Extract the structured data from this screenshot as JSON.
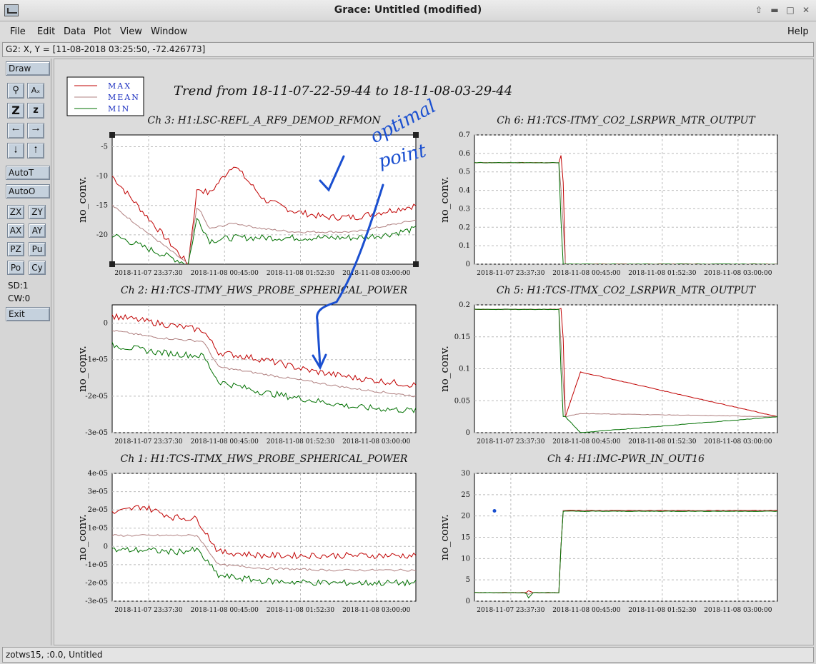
{
  "window": {
    "title": "Grace: Untitled (modified)"
  },
  "menu": {
    "file": "File",
    "edit": "Edit",
    "data": "Data",
    "plot": "Plot",
    "view": "View",
    "window": "Window",
    "help": "Help"
  },
  "locator": "G2: X, Y = [11-08-2018 03:25:50, -72.426773]",
  "toolbar": {
    "draw": "Draw",
    "autot": "AutoT",
    "autoo": "AutoO",
    "zx": "ZX",
    "zy": "ZY",
    "ax": "AX",
    "ay": "AY",
    "pz": "PZ",
    "pu": "Pu",
    "po": "Po",
    "cy": "Cy",
    "sd": "SD:1",
    "cw": "CW:0",
    "exit": "Exit",
    "zoom_big": "Z",
    "zoom_small": "z",
    "text_tool": "Aₓ"
  },
  "status": "zotws15, :0.0, Untitled",
  "legend": {
    "max": "MAX",
    "mean": "MEAN",
    "min": "MIN"
  },
  "page_title": "Trend from 18-11-07-22-59-44 to 18-11-08-03-29-44",
  "annotation": {
    "text": "optimal point"
  },
  "colors": {
    "max": "#c00000",
    "mean": "#b08080",
    "min": "#007000",
    "annot": "#1a4fd0",
    "frame": "#000000"
  },
  "common": {
    "ylabel": "no_conv.",
    "xticks": [
      "2018-11-07 23:37:30",
      "2018-11-08 00:45:00",
      "2018-11-08 01:52:30",
      "2018-11-08 03:00:00"
    ]
  },
  "chart_data": [
    {
      "type": "line",
      "title": "Ch 3: H1:LSC-REFL_A_RF9_DEMOD_RFMON",
      "ylabel": "no_conv.",
      "ylim": [
        -25,
        -3
      ],
      "yticks": [
        "-5",
        "-10",
        "-15",
        "-20"
      ],
      "x": [
        0,
        0.25,
        0.28,
        0.32,
        0.4,
        0.5,
        0.6,
        0.7,
        0.8,
        0.9,
        1.0
      ],
      "series": [
        {
          "name": "MAX",
          "values": [
            -10,
            -25,
            -12,
            -13,
            -8,
            -14,
            -16,
            -17,
            -17,
            -16,
            -15
          ]
        },
        {
          "name": "MEAN",
          "values": [
            -15,
            -25,
            -15,
            -19,
            -18,
            -19,
            -19.5,
            -19.5,
            -19.5,
            -18.5,
            -17.5
          ]
        },
        {
          "name": "MIN",
          "values": [
            -20,
            -25,
            -17,
            -21,
            -20.5,
            -20.5,
            -20.5,
            -20.5,
            -20.5,
            -20,
            -19
          ]
        }
      ],
      "grid": true
    },
    {
      "type": "line",
      "title": "Ch 6: H1:TCS-ITMY_CO2_LSRPWR_MTR_OUTPUT",
      "ylabel": "no_conv.",
      "ylim": [
        0,
        0.7
      ],
      "yticks": [
        "0.7",
        "0.6",
        "0.5",
        "0.4",
        "0.3",
        "0.2",
        "0.1",
        "0"
      ],
      "x": [
        0,
        0.28,
        0.29,
        0.3,
        1.0
      ],
      "series": [
        {
          "name": "MAX",
          "values": [
            0.55,
            0.55,
            0.62,
            0.0,
            0.0
          ]
        },
        {
          "name": "MEAN",
          "values": [
            0.55,
            0.55,
            0.3,
            0.0,
            0.0
          ]
        },
        {
          "name": "MIN",
          "values": [
            0.55,
            0.55,
            0.0,
            0.0,
            0.0
          ]
        }
      ],
      "grid": true
    },
    {
      "type": "line",
      "title": "Ch 2: H1:TCS-ITMY_HWS_PROBE_SPHERICAL_POWER",
      "ylabel": "no_conv.",
      "ylim": [
        -3e-05,
        5e-06
      ],
      "yticks": [
        "0",
        "-1e-05",
        "-2e-05",
        "-3e-05"
      ],
      "x": [
        0,
        0.15,
        0.3,
        0.35,
        0.5,
        0.65,
        0.8,
        1.0
      ],
      "series": [
        {
          "name": "MAX",
          "values": [
            2e-06,
            0.0,
            -2e-06,
            -8e-06,
            -1e-05,
            -1.3e-05,
            -1.5e-05,
            -1.7e-05
          ]
        },
        {
          "name": "MEAN",
          "values": [
            -2e-06,
            -4e-06,
            -5e-06,
            -1.2e-05,
            -1.4e-05,
            -1.6e-05,
            -1.8e-05,
            -2e-05
          ]
        },
        {
          "name": "MIN",
          "values": [
            -6e-06,
            -8e-06,
            -9e-06,
            -1.6e-05,
            -1.9e-05,
            -2.1e-05,
            -2.3e-05,
            -2.4e-05
          ]
        }
      ],
      "grid": true
    },
    {
      "type": "line",
      "title": "Ch 5: H1:TCS-ITMX_CO2_LSRPWR_MTR_OUTPUT",
      "ylabel": "no_conv.",
      "ylim": [
        0,
        0.2
      ],
      "yticks": [
        "0.2",
        "0.15",
        "0.1",
        "0.05",
        "0"
      ],
      "x": [
        0,
        0.28,
        0.29,
        0.3,
        0.35,
        1.0
      ],
      "series": [
        {
          "name": "MAX",
          "values": [
            0.193,
            0.193,
            0.195,
            0.025,
            0.095,
            0.025
          ]
        },
        {
          "name": "MEAN",
          "values": [
            0.193,
            0.193,
            0.1,
            0.025,
            0.03,
            0.025
          ]
        },
        {
          "name": "MIN",
          "values": [
            0.193,
            0.193,
            0.025,
            0.025,
            0.0,
            0.025
          ]
        }
      ],
      "grid": true
    },
    {
      "type": "line",
      "title": "Ch 1: H1:TCS-ITMX_HWS_PROBE_SPHERICAL_POWER",
      "ylabel": "no_conv.",
      "ylim": [
        -3e-05,
        4e-05
      ],
      "yticks": [
        "4e-05",
        "3e-05",
        "2e-05",
        "1e-05",
        "0",
        "-1e-05",
        "-2e-05",
        "-3e-05"
      ],
      "x": [
        0,
        0.1,
        0.2,
        0.28,
        0.35,
        0.5,
        0.7,
        1.0
      ],
      "series": [
        {
          "name": "MAX",
          "values": [
            1.8e-05,
            2.2e-05,
            1.6e-05,
            1.5e-05,
            -3e-06,
            -5e-06,
            -5e-06,
            -5e-06
          ]
        },
        {
          "name": "MEAN",
          "values": [
            6e-06,
            6e-06,
            6e-06,
            6e-06,
            -1e-05,
            -1.2e-05,
            -1.3e-05,
            -1.3e-05
          ]
        },
        {
          "name": "MIN",
          "values": [
            -2e-06,
            -2e-06,
            -3e-06,
            -2e-06,
            -1.6e-05,
            -1.9e-05,
            -2e-05,
            -2e-05
          ]
        }
      ],
      "grid": true
    },
    {
      "type": "line",
      "title": "Ch 4: H1:IMC-PWR_IN_OUT16",
      "ylabel": "no_conv.",
      "ylim": [
        0,
        30
      ],
      "yticks": [
        "30",
        "25",
        "20",
        "15",
        "10",
        "5",
        "0"
      ],
      "x": [
        0,
        0.17,
        0.18,
        0.19,
        0.28,
        0.29,
        1.0
      ],
      "series": [
        {
          "name": "MAX",
          "values": [
            2,
            2,
            2.5,
            2,
            2,
            21.3,
            21.3
          ]
        },
        {
          "name": "MEAN",
          "values": [
            2,
            2,
            1.5,
            2,
            2,
            21.2,
            21.2
          ]
        },
        {
          "name": "MIN",
          "values": [
            2,
            2,
            0.5,
            2,
            2,
            21.1,
            21.1
          ]
        }
      ],
      "grid": true
    }
  ]
}
